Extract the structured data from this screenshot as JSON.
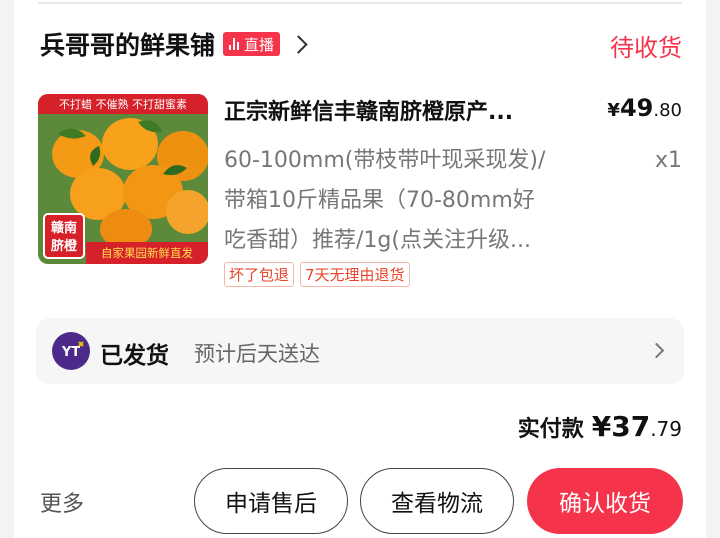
{
  "shop": {
    "name": "兵哥哥的鲜果铺",
    "live_label": "直播"
  },
  "order_status": "待收货",
  "product": {
    "title": "正宗新鲜信丰赣南脐橙原产...",
    "price_symbol": "¥",
    "price_int": "49",
    "price_dec": ".80",
    "spec_lines": [
      "60-100mm(带枝带叶现采现发)/",
      "带箱10斤精品果（70-80mm好",
      "吃香甜）推荐/1g(点关注升级..."
    ],
    "quantity": "x1",
    "thumb_texts": {
      "top_banner": "不打蜡  不催熟  不打甜蜜素",
      "badge_line1": "赣南",
      "badge_line2": "脐橙",
      "bottom_banner": "自家果园新鲜直发"
    },
    "tags": [
      "坏了包退",
      "7天无理由退货"
    ]
  },
  "shipping": {
    "logo_text": "YT",
    "label": "已发货",
    "desc": "预计后天送达"
  },
  "payment": {
    "label": "实付款",
    "symbol": "¥",
    "int": "37",
    "dec": ".79"
  },
  "actions": {
    "more": "更多",
    "after_sale": "申请售后",
    "logistics": "查看物流",
    "confirm": "确认收货"
  },
  "colors": {
    "accent": "#f5334a",
    "tag_text": "#e8452c"
  }
}
